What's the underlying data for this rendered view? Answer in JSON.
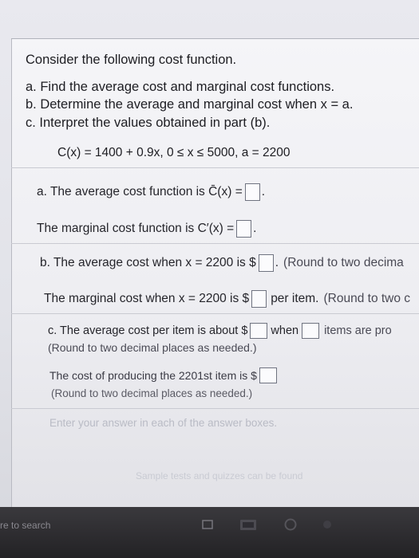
{
  "problem": {
    "title": "Consider the following cost function.",
    "parts": [
      "a. Find the average cost and marginal cost functions.",
      "b. Determine the average and marginal cost when x = a.",
      "c. Interpret the values obtained in part (b)."
    ],
    "function": "C(x) = 1400 + 0.9x, 0 ≤ x ≤ 5000, a = 2200"
  },
  "answers": {
    "avg_fn": "a. The average cost function is C̄(x) =",
    "marg_fn": "The marginal cost function is C′(x) =",
    "avg_at": "b. The average cost when x = 2200 is $",
    "avg_at_hint": "(Round to two decima",
    "marg_at": "The marginal cost when x = 2200 is $",
    "marg_at_mid": "per item.",
    "marg_at_hint": "(Round to two c",
    "interp_prefix": "c. The average cost per item is about $",
    "interp_when": "when",
    "interp_suffix": "items are pro",
    "interp_round": "(Round to two decimal places as needed.)",
    "cost2201": "The cost of producing the 2201st item is $",
    "cost2201_round": "(Round to two decimal places as needed.)",
    "enter_hint": "Enter your answer in each of the answer boxes.",
    "footer_faint": "Sample tests and quizzes can be found"
  },
  "taskbar": {
    "search_text": "re to search"
  }
}
